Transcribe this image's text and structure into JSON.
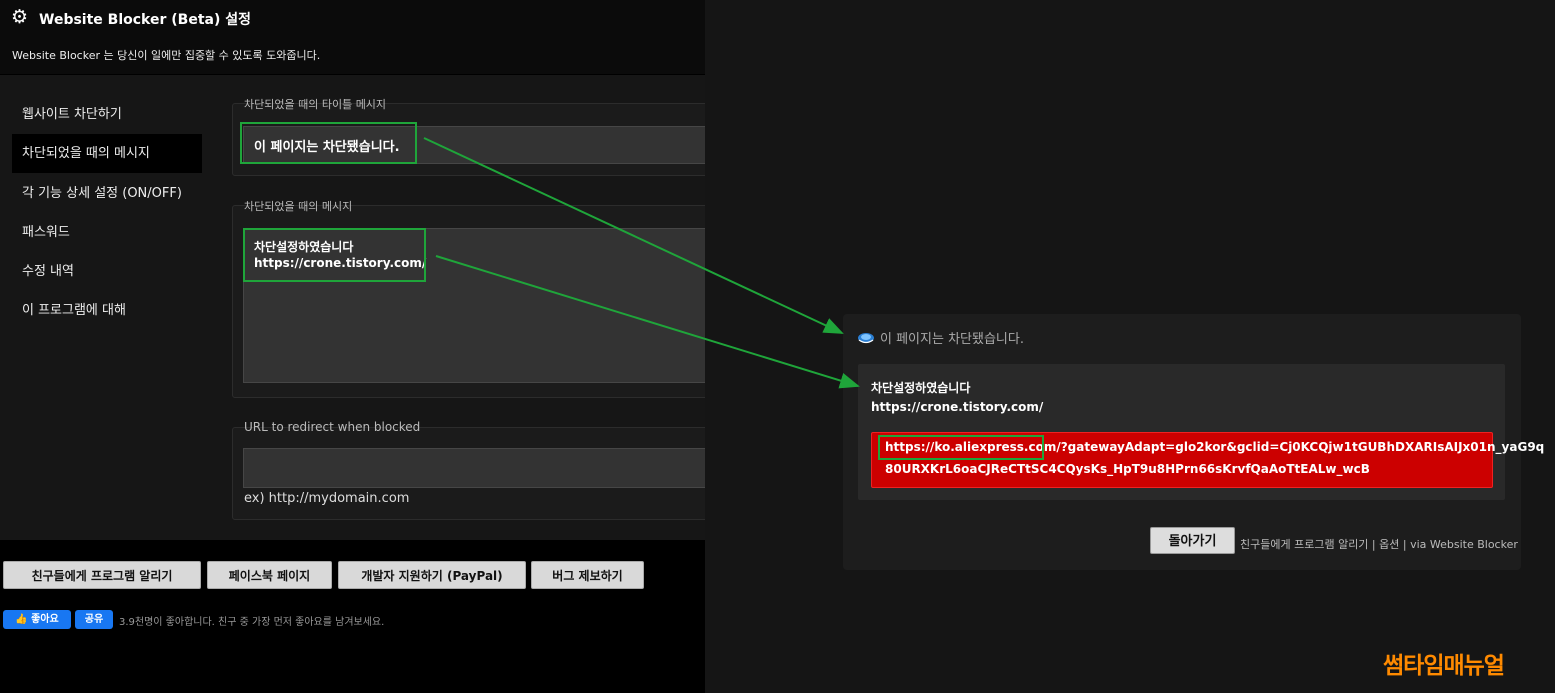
{
  "header": {
    "title": "Website Blocker (Beta) 설정",
    "description": "Website Blocker 는 당신이 일에만 집중할 수 있도록 도와줍니다."
  },
  "sidebar": {
    "items": [
      {
        "label": "웹사이트 차단하기"
      },
      {
        "label": "차단되었을 때의 메시지",
        "active": true
      },
      {
        "label": "각 기능 상세 설정 (ON/OFF)"
      },
      {
        "label": "패스워드"
      },
      {
        "label": "수정 내역"
      },
      {
        "label": "이 프로그램에 대해"
      }
    ]
  },
  "settings": {
    "title_section": {
      "legend": "차단되었을 때의 타이틀 메시지",
      "value": "이 페이지는 차단됐습니다."
    },
    "message_section": {
      "legend": "차단되었을 때의 메시지",
      "line1": "차단설정하였습니다",
      "line2": "https://crone.tistory.com/"
    },
    "redirect_section": {
      "legend": "URL to redirect when blocked",
      "value": "",
      "hint": "ex) http://mydomain.com"
    }
  },
  "footer": {
    "buttons": [
      {
        "label": "친구들에게 프로그램 알리기"
      },
      {
        "label": "페이스북 페이지"
      },
      {
        "label": "개발자 지원하기 (PayPal)"
      },
      {
        "label": "버그 제보하기"
      }
    ],
    "facebook": {
      "like_label": "좋아요",
      "share_label": "공유",
      "text": "3.9천명이 좋아합니다. 친구 중 가장 먼저 좋아요를 남겨보세요."
    }
  },
  "blocked_page": {
    "title": "이 페이지는 차단됐습니다.",
    "message_line1": "차단설정하였습니다",
    "message_line2": "https://crone.tistory.com/",
    "blocked_url_line1_highlight": "https://ko.aliexpress.com/",
    "blocked_url_line1_rest": "?gatewayAdapt=glo2kor&gclid=Cj0KCQjw1tGUBhDXARIsAIJx01n_yaG9q",
    "blocked_url_line2": "80URXKrL6oaCJReCTtSC4CQysKs_HpT9u8HPrn66sKrvfQaAoTtEALw_wcB",
    "back_button": "돌아가기",
    "footer_text": "친구들에게 프로그램 알리기 | 옵션 | via Website Blocker"
  },
  "watermark": "썸타임매뉴얼",
  "colors": {
    "highlight_green": "#1fa53a",
    "blocked_url_red": "#cc0000",
    "facebook_blue": "#1877f2",
    "watermark_orange": "#ff8a00"
  }
}
